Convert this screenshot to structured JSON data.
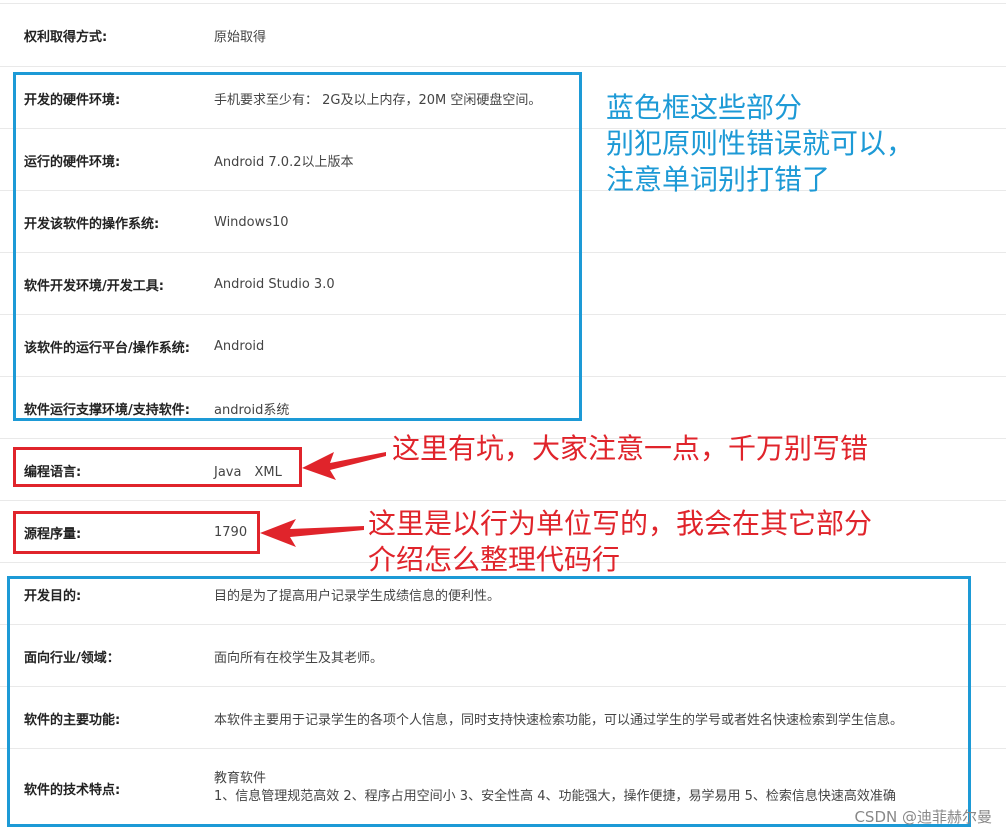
{
  "rows": [
    {
      "label": "权利取得方式:",
      "value": "原始取得"
    },
    {
      "label": "开发的硬件环境:",
      "value": "手机要求至少有： 2G及以上内存，20M 空闲硬盘空间。"
    },
    {
      "label": "运行的硬件环境:",
      "value": "Android 7.0.2以上版本"
    },
    {
      "label": "开发该软件的操作系统:",
      "value": "Windows10"
    },
    {
      "label": "软件开发环境/开发工具:",
      "value": "Android Studio 3.0"
    },
    {
      "label": "该软件的运行平台/操作系统:",
      "value": "Android"
    },
    {
      "label": "软件运行支撑环境/支持软件:",
      "value": "android系统"
    },
    {
      "label": "编程语言:",
      "value": "Java　XML"
    },
    {
      "label": "源程序量:",
      "value": "1790"
    },
    {
      "label": "开发目的:",
      "value": "目的是为了提高用户记录学生成绩信息的便利性。"
    },
    {
      "label": "面向行业/领域：",
      "value": "面向所有在校学生及其老师。"
    },
    {
      "label": "软件的主要功能:",
      "value": "本软件主要用于记录学生的各项个人信息，同时支持快速检索功能，可以通过学生的学号或者姓名快速检索到学生信息。"
    },
    {
      "label": "软件的技术特点:",
      "value_line1": "教育软件",
      "value_line2": "1、信息管理规范高效 2、程序占用空间小 3、安全性高 4、功能强大，操作便捷，易学易用 5、检索信息快速高效准确"
    }
  ],
  "annotations": {
    "blue_note_line1": "蓝色框这些部分",
    "blue_note_line2": "别犯原则性错误就可以，",
    "blue_note_line3": "注意单词别打错了",
    "red_note_1": "这里有坑，大家注意一点，千万别写错",
    "red_note_2_line1": "这里是以行为单位写的，我会在其它部分",
    "red_note_2_line2": "介绍怎么整理代码行"
  },
  "watermark": "CSDN @迪菲赫尔曼",
  "colors": {
    "blue_box": "#1d9ad6",
    "red_box": "#e0242b"
  }
}
